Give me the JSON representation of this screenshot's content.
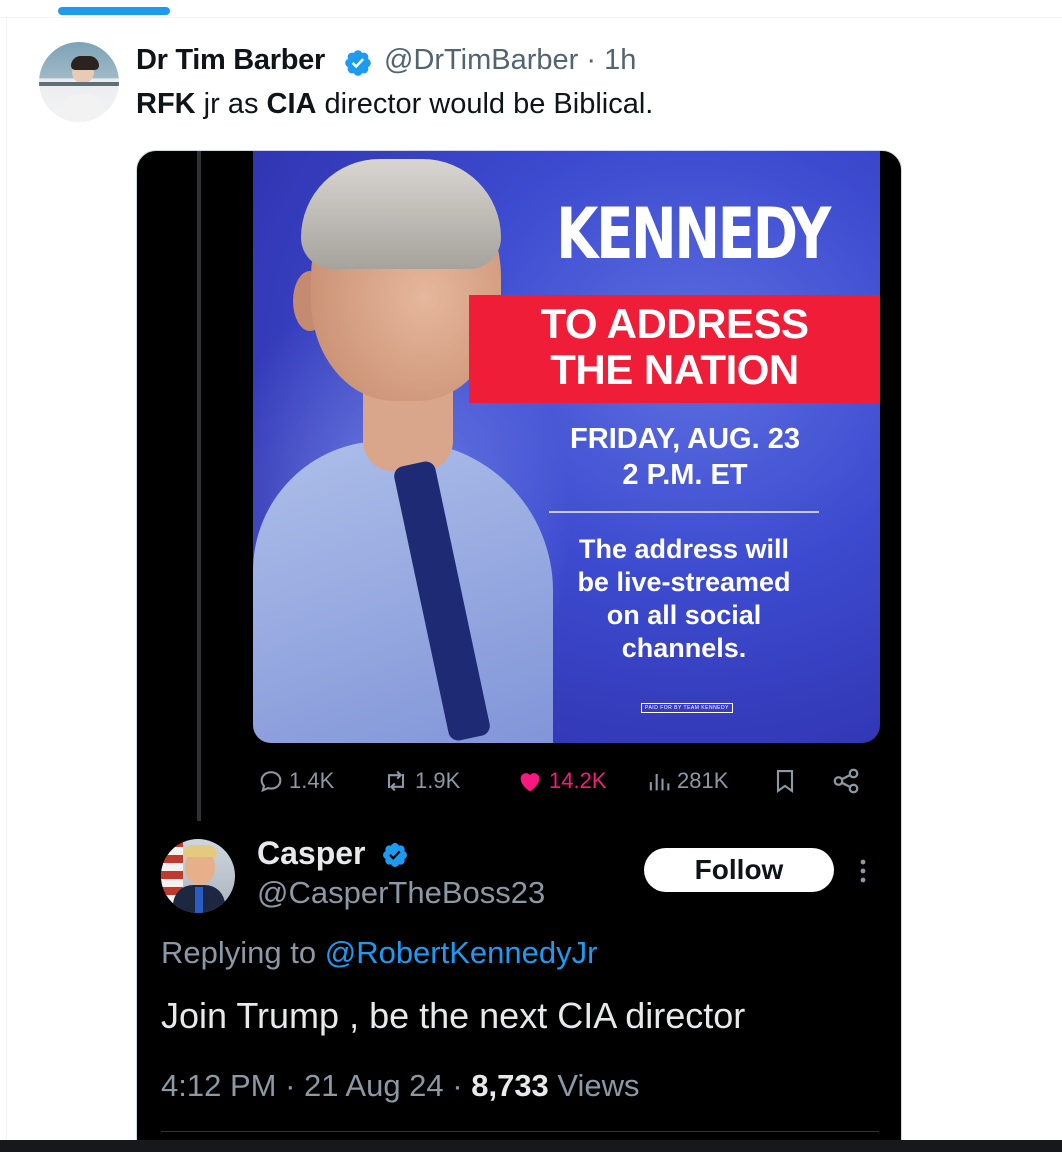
{
  "outer_tweet": {
    "display_name": "Dr Tim Barber",
    "handle": "@DrTimBarber",
    "separator": " · ",
    "time": "1h",
    "text_parts": [
      "RFK",
      " jr as ",
      "CIA",
      " director would be Biblical."
    ]
  },
  "poster": {
    "headline": "KENNEDY",
    "banner_line1": "TO ADDRESS",
    "banner_line2": "THE NATION",
    "date_line": "FRIDAY, AUG. 23",
    "time_line": "2 P.M. ET",
    "stream_line1": "The address will",
    "stream_line2": "be live-streamed",
    "stream_line3": "on all social",
    "stream_line4": "channels.",
    "disclaimer": "PAID FOR BY TEAM KENNEDY"
  },
  "actions": {
    "replies": "1.4K",
    "reposts": "1.9K",
    "likes": "14.2K",
    "views": "281K"
  },
  "reply_tweet": {
    "display_name": "Casper",
    "handle": "@CasperTheBoss23",
    "follow_label": "Follow",
    "replying_prefix": "Replying to ",
    "replying_to": "@RobertKennedyJr",
    "text": "Join Trump , be the next CIA director",
    "time": "4:12 PM",
    "separator": " · ",
    "date": "21 Aug 24",
    "view_count": "8,733",
    "views_label": " Views"
  },
  "colors": {
    "verified_blue": "#1d9bf0",
    "like_pink": "#f91880",
    "banner_red": "#ef1d37"
  }
}
